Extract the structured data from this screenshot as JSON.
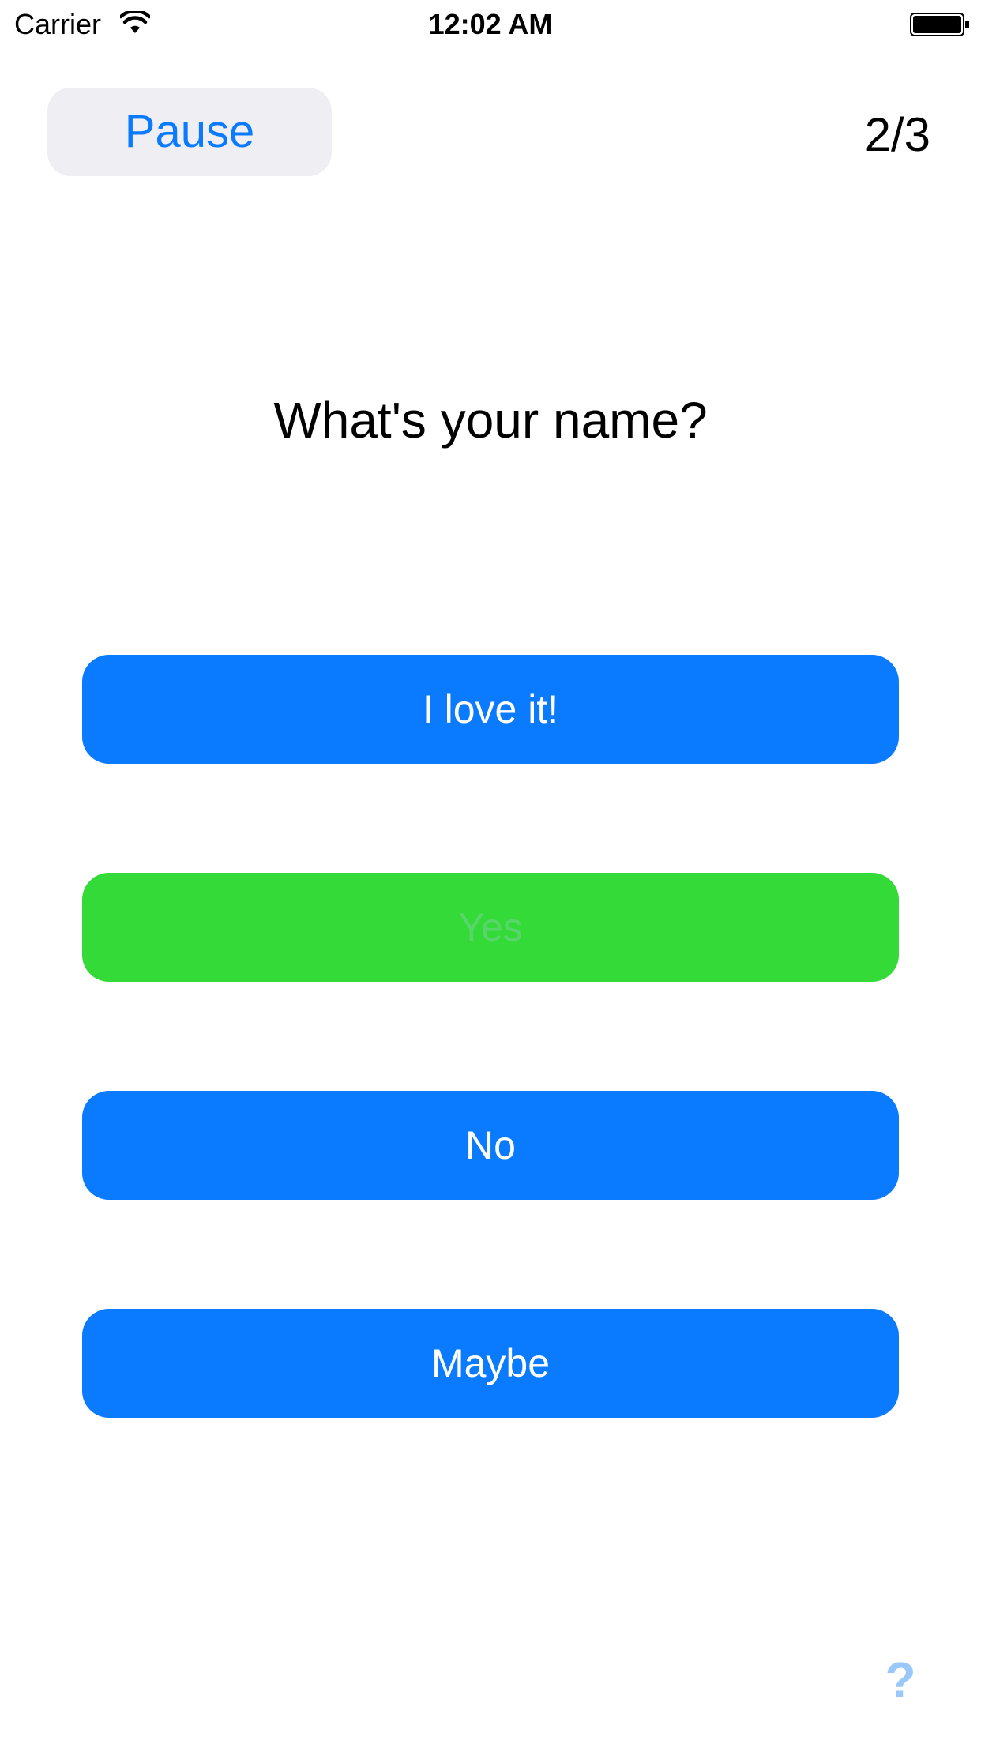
{
  "status_bar": {
    "carrier": "Carrier",
    "time": "12:02 AM",
    "wifi_icon": "wifi-icon",
    "battery_icon": "battery-full-icon"
  },
  "header": {
    "pause_label": "Pause",
    "progress": "2/3"
  },
  "question": {
    "text": "What's your name?"
  },
  "answers": [
    {
      "label": "I love it!",
      "color": "#0a7aff"
    },
    {
      "label": "Yes",
      "color": "#34da38",
      "text_color": "#58d66c"
    },
    {
      "label": "No",
      "color": "#0a7aff"
    },
    {
      "label": "Maybe",
      "color": "#0a7aff"
    }
  ],
  "help": {
    "label": "?",
    "color": "#9ac8fb"
  },
  "colors": {
    "accent": "#0a7aff",
    "pause_bg": "#eeeef3"
  }
}
